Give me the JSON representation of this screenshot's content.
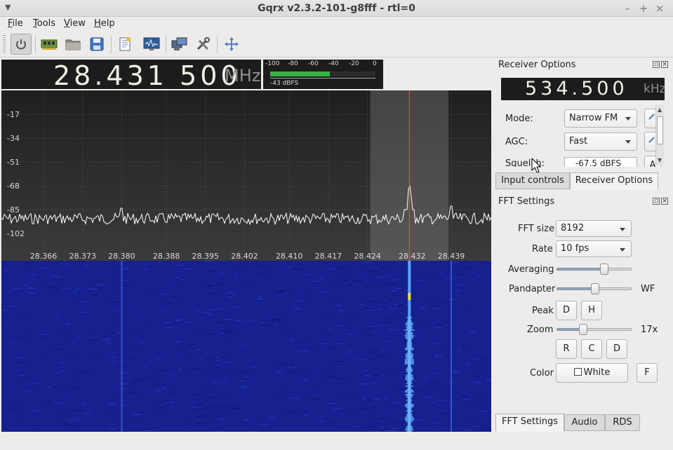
{
  "window": {
    "title": "Gqrx v2.3.2-101-g8fff - rtl=0",
    "minimize": "–",
    "maximize": "+",
    "close": "×"
  },
  "menu": [
    "File",
    "Tools",
    "View",
    "Help"
  ],
  "toolbar": {
    "icons": [
      "power-icon",
      "hardware-card-icon",
      "open-folder-icon",
      "save-icon",
      "bookmark-icon",
      "fft-monitor-icon",
      "remote-control-icon",
      "tools-icon",
      "fullscreen-icon"
    ]
  },
  "frequency": {
    "value": "28.431 500",
    "unit": "MHz"
  },
  "smeter": {
    "ticks": [
      "-100",
      "-80",
      "-60",
      "-40",
      "-20",
      "0"
    ],
    "level_dbfs": -43,
    "level_label": "-43 dBFS",
    "range": [
      -100,
      0
    ]
  },
  "plot": {
    "y_ticks": [
      "-17",
      "-34",
      "-51",
      "-68",
      "-85",
      "-102"
    ],
    "x_ticks": [
      "28.366",
      "28.373",
      "28.380",
      "28.388",
      "28.395",
      "28.402",
      "28.410",
      "28.417",
      "28.424",
      "28.432",
      "28.439"
    ],
    "signal_freqs": [
      28.38,
      28.4315,
      28.439
    ],
    "filter_band": [
      28.4245,
      28.4385
    ],
    "colors": {
      "trace": "#ffffff",
      "marker": "#ff4b4b",
      "waterfall_bg": "#16208f",
      "filter": "#8a8a8a"
    }
  },
  "receiver": {
    "title": "Receiver Options",
    "offset_value": "534.500",
    "offset_unit": "kHz",
    "mode_label": "Mode:",
    "mode_value": "Narrow FM",
    "agc_label": "AGC:",
    "agc_value": "Fast",
    "squelch_label": "Squelch:",
    "squelch_value": "-67.5 dBFS",
    "squelch_btn": "A"
  },
  "top_tabs": [
    "Input controls",
    "Receiver Options"
  ],
  "fft": {
    "title": "FFT Settings",
    "size_label": "FFT size",
    "size_value": "8192",
    "rate_label": "Rate",
    "rate_value": "10 fps",
    "averaging_label": "Averaging",
    "averaging_pos": 0.63,
    "pandapter_label": "Pandapter",
    "pandapter_pos": 0.5,
    "wf_label": "WF",
    "peak_label": "Peak",
    "peak_d": "D",
    "peak_h": "H",
    "zoom_label": "Zoom",
    "zoom_pos": 0.35,
    "zoom_value": "17x",
    "zoom_r": "R",
    "zoom_c": "C",
    "zoom_d": "D",
    "color_label": "Color",
    "color_value": "White",
    "color_f": "F"
  },
  "bottom_tabs": [
    "FFT Settings",
    "Audio",
    "RDS"
  ]
}
